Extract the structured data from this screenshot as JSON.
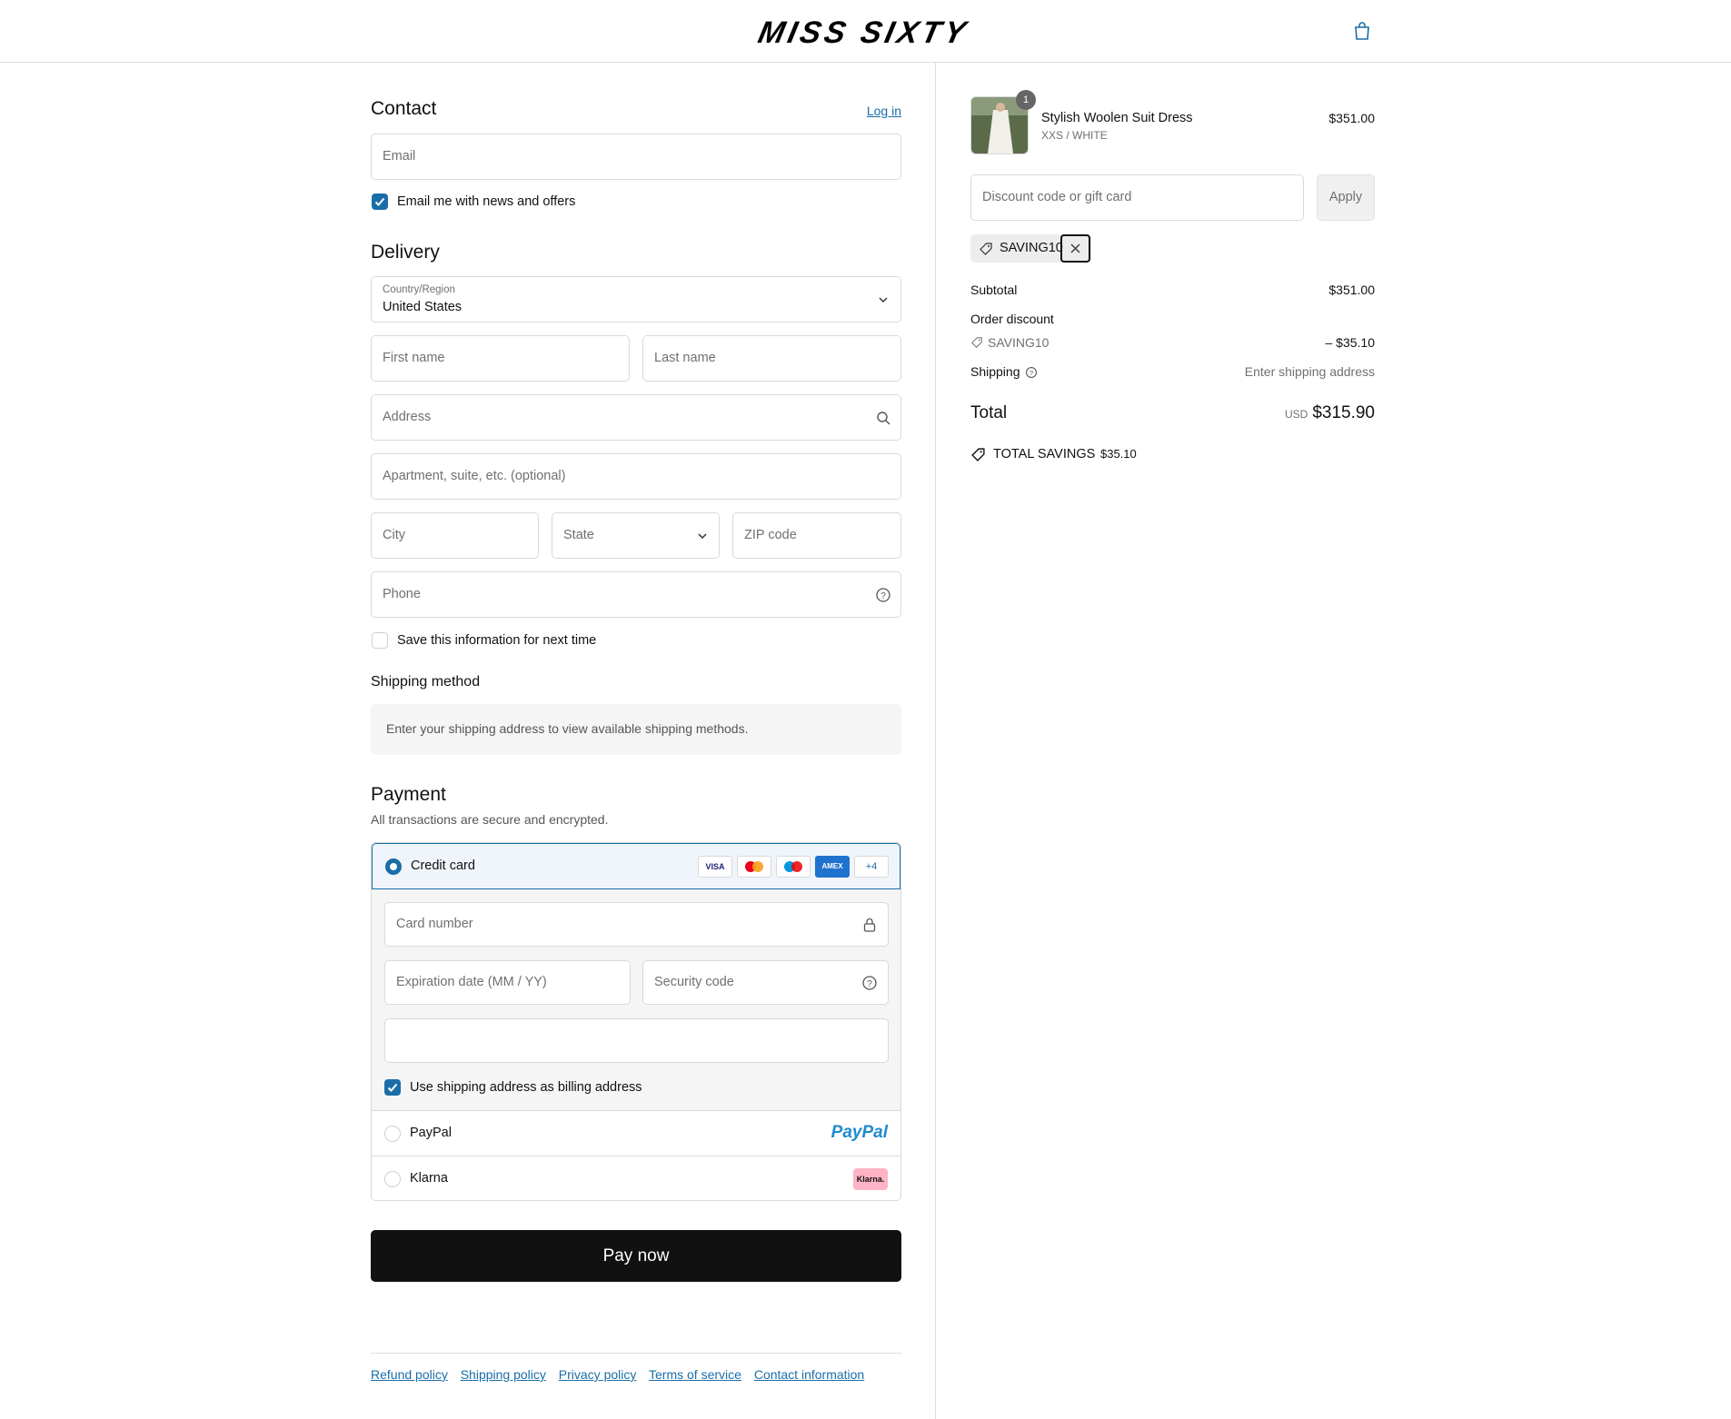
{
  "header": {
    "logo": "MISS SIXTY"
  },
  "contact": {
    "title": "Contact",
    "login_link": "Log in",
    "email_placeholder": "Email",
    "news_label": "Email me with news and offers"
  },
  "delivery": {
    "title": "Delivery",
    "country_label": "Country/Region",
    "country_value": "United States",
    "first_name": "First name",
    "last_name": "Last name",
    "address": "Address",
    "apartment": "Apartment, suite, etc. (optional)",
    "city": "City",
    "state": "State",
    "zip": "ZIP code",
    "phone": "Phone",
    "save_info_label": "Save this information for next time"
  },
  "shipping_method": {
    "title": "Shipping method",
    "note": "Enter your shipping address to view available shipping methods."
  },
  "payment": {
    "title": "Payment",
    "subtitle": "All transactions are secure and encrypted.",
    "credit_card_label": "Credit card",
    "card_logos": [
      "VISA",
      "mastercard",
      "maestro",
      "AMEX"
    ],
    "more_cards": "+4",
    "card_number": "Card number",
    "expiration": "Expiration date (MM / YY)",
    "security_code": "Security code",
    "billing_label": "Use shipping address as billing address",
    "paypal_label": "PayPal",
    "paypal_logo": "PayPal",
    "klarna_label": "Klarna",
    "klarna_logo": "Klarna."
  },
  "pay_button": "Pay now",
  "footer_links": [
    "Refund policy",
    "Shipping policy",
    "Privacy policy",
    "Terms of service",
    "Contact information"
  ],
  "summary": {
    "product_name": "Stylish Woolen Suit Dress",
    "product_variant": "XXS / WHITE",
    "product_price": "$351.00",
    "quantity": "1",
    "discount_placeholder": "Discount code or gift card",
    "apply_label": "Apply",
    "applied_code": "SAVING10",
    "subtotal_label": "Subtotal",
    "subtotal_value": "$351.00",
    "order_discount_label": "Order discount",
    "discount_code": "SAVING10",
    "discount_value": "– $35.10",
    "shipping_label": "Shipping",
    "shipping_value": "Enter shipping address",
    "total_label": "Total",
    "total_currency": "USD",
    "total_value": "$315.90",
    "savings_label": "TOTAL SAVINGS",
    "savings_value": "$35.10"
  },
  "colors": {
    "accent": "#1a6ea8",
    "button": "#111111"
  }
}
